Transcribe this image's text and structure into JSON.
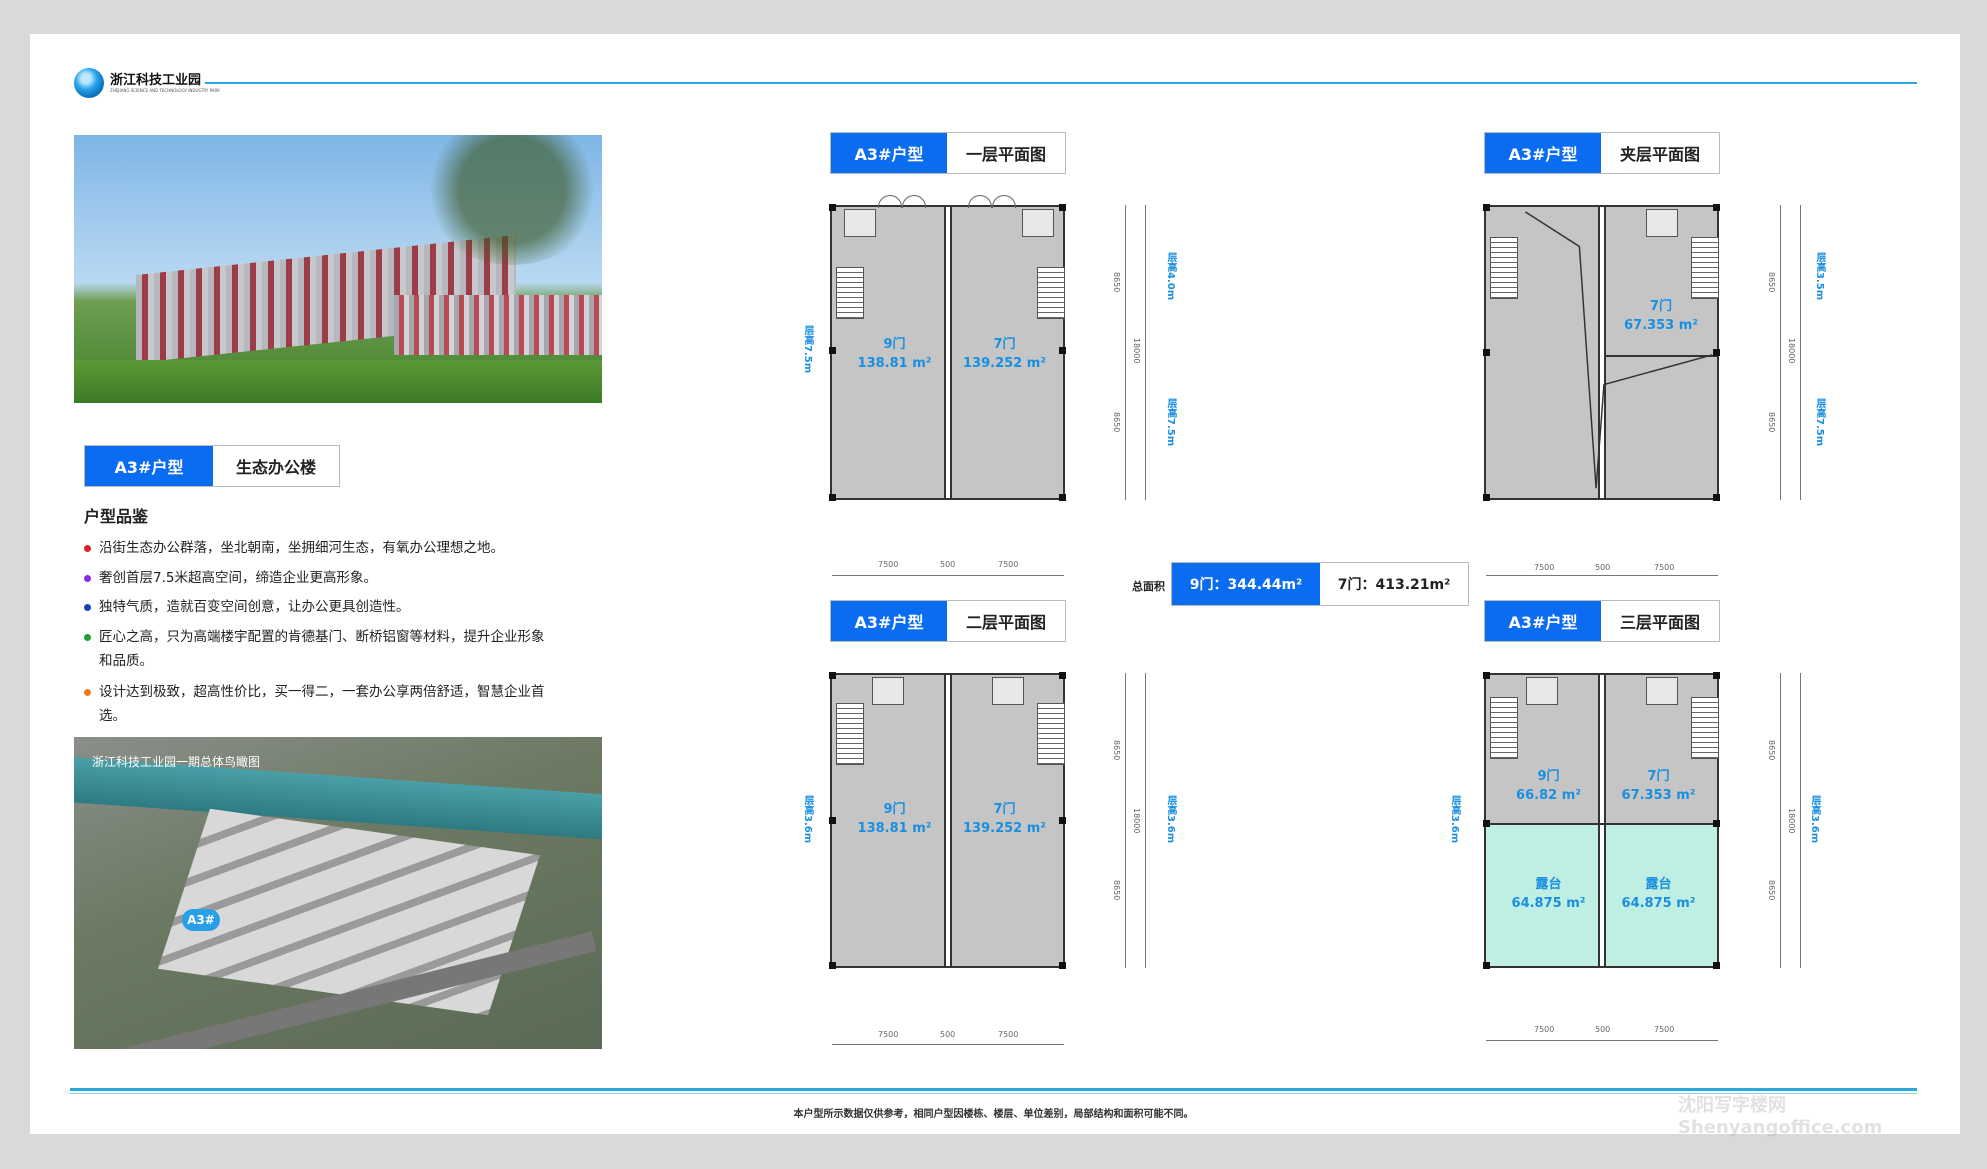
{
  "header": {
    "logo_cn": "浙江科技工业园",
    "logo_en": "ZHEJIANG SCIENCE AND TECHNOLOGY INDUSTRY PARK"
  },
  "left": {
    "tag_a": "A3#户型",
    "tag_b": "生态办公楼",
    "feature_title": "户型品鉴",
    "features": [
      {
        "text": "沿街生态办公群落，坐北朝南，坐拥细河生态，有氧办公理想之地。",
        "color": "#e02020"
      },
      {
        "text": "奢创首层7.5米超高空间，缔造企业更高形象。",
        "color": "#8a2be2"
      },
      {
        "text": "独特气质，造就百变空间创意，让办公更具创造性。",
        "color": "#1a3fbf"
      },
      {
        "text": "匠心之高，只为高端楼宇配置的肯德基门、断桥铝窗等材料，提升企业形象和品质。",
        "color": "#1f9d3a"
      },
      {
        "text": "设计达到极致，超高性价比，买一得二，一套办公享两倍舒适，智慧企业首选。",
        "color": "#f07b1a"
      }
    ],
    "aerial_caption": "浙江科技工业园一期总体鸟瞰图",
    "aerial_pin": "A3#"
  },
  "plans": {
    "f1": {
      "tag_a": "A3#户型",
      "tag_b": "一层平面图",
      "left_name": "9门",
      "left_area": "138.81 m²",
      "right_name": "7门",
      "right_area": "139.252 m²",
      "h_left": "层高7.5m",
      "h_right_top": "层高4.0m",
      "h_right_bot": "层高7.5m"
    },
    "mz": {
      "tag_a": "A3#户型",
      "tag_b": "夹层平面图",
      "right_name": "7门",
      "right_area": "67.353 m²",
      "h_right_top": "层高3.5m",
      "h_right_bot": "层高7.5m"
    },
    "f2": {
      "tag_a": "A3#户型",
      "tag_b": "二层平面图",
      "left_name": "9门",
      "left_area": "138.81 m²",
      "right_name": "7门",
      "right_area": "139.252 m²",
      "h_left": "层高3.6m",
      "h_right": "层高3.6m"
    },
    "f3": {
      "tag_a": "A3#户型",
      "tag_b": "三层平面图",
      "left_name": "9门",
      "left_area": "66.82 m²",
      "right_name": "7门",
      "right_area": "67.353 m²",
      "terrace_left_name": "露台",
      "terrace_left_area": "64.875 m²",
      "terrace_right_name": "露台",
      "terrace_right_area": "64.875 m²",
      "h_left": "层高3.6m",
      "h_right": "层高3.6m"
    },
    "dims": {
      "w1": "7500",
      "w2": "500",
      "w3": "7500",
      "d1": "8650",
      "d2": "18000",
      "d3": "8650"
    }
  },
  "total": {
    "label": "总面积",
    "a": "9门：344.44m²",
    "b": "7门：413.21m²"
  },
  "footer": "本户型所示数据仅供参考，相同户型因楼栋、楼层、单位差别，局部结构和面积可能不同。",
  "watermark": [
    "沈阳写字楼网",
    "Shenyangoffice.com"
  ]
}
